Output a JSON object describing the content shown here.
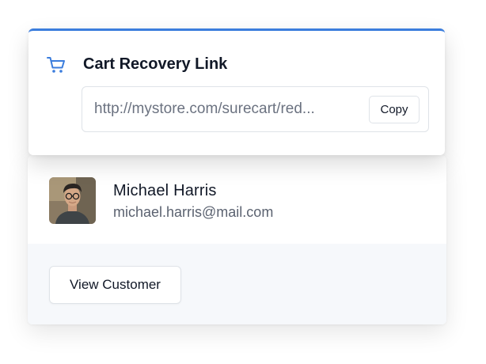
{
  "recovery": {
    "icon": "shopping-cart-icon",
    "title": "Cart Recovery Link",
    "link_value": "http://mystore.com/surecart/red...",
    "copy_label": "Copy"
  },
  "customer": {
    "avatar_icon": "customer-avatar",
    "name": "Michael Harris",
    "email": "michael.harris@mail.com",
    "view_label": "View Customer"
  },
  "colors": {
    "accent": "#3b7ddd",
    "title_text": "#111827",
    "muted_text": "#6b7280",
    "footer_bg": "#f6f8fb"
  }
}
